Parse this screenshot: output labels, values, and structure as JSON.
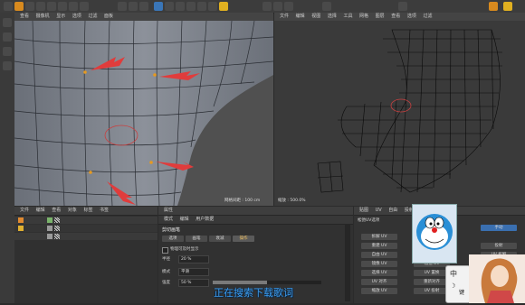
{
  "toolbar": {
    "buttons": [
      "undo",
      "move",
      "scale",
      "rotate",
      "x",
      "y",
      "z",
      "coord",
      "render",
      "render-view",
      "render-settings",
      "cube",
      "pen",
      "subdivide",
      "deformer",
      "environment",
      "camera",
      "light",
      "mode-points",
      "mode-edges",
      "mode-polygons",
      "snap",
      "python"
    ]
  },
  "viewport_left": {
    "menu": [
      "查看",
      "摄像机",
      "显示",
      "选项",
      "过滤",
      "面板"
    ],
    "status": "网格间距 : 100 cm",
    "label": "透视视图"
  },
  "viewport_right": {
    "menu": [
      "文件",
      "编辑",
      "视图",
      "选择",
      "工具",
      "网格",
      "图层",
      "查看",
      "选项",
      "过滤"
    ],
    "status": "缩放 : 500.0%"
  },
  "object_panel": {
    "menu": [
      "文件",
      "编辑",
      "查看",
      "对象",
      "标签",
      "书签"
    ],
    "rows": [
      "",
      "",
      ""
    ]
  },
  "attr_panel": {
    "title": "属性",
    "menu": [
      "模式",
      "编辑",
      "用户数据"
    ],
    "tool_title": "剪切画笔",
    "tabs": [
      "选项",
      "画笔",
      "衰减",
      "操作"
    ],
    "checkbox_label": "物理可及时显示",
    "radius_label": "半径",
    "radius_value": "20 %",
    "mode_label": "模式",
    "mode_value": "平滑",
    "strength_label": "强度",
    "strength_value": "50 %"
  },
  "uv_panel": {
    "tabs": [
      "贴图",
      "UV",
      "自由",
      "投射",
      "松弛"
    ],
    "header": "松弛UV选项",
    "buttons_left": [
      "拆解 UV",
      "重建 UV",
      "自由 UV",
      "镜像 UV",
      "选择 UV",
      "UV 对齐",
      "缩放 UV"
    ],
    "buttons_right": [
      "手动",
      "投射",
      "UV 拆解",
      "松弛 UV",
      "UV 置换",
      "重新对齐",
      "UV 投射"
    ]
  },
  "subtitle": "正在搜索下载歌词",
  "overlay": {
    "ime_label": "中",
    "ime_moon": "☽",
    "ime_key": "键"
  },
  "colors": {
    "accent": "#e06c1e",
    "arrow": "#e04040",
    "subtitle": "#3b9cf0"
  }
}
